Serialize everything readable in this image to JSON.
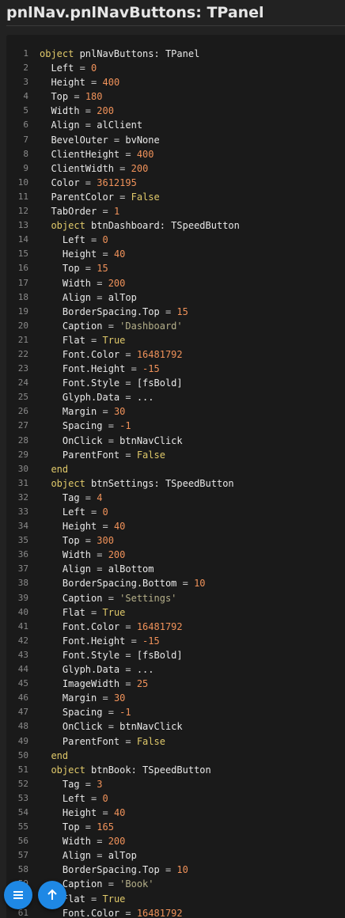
{
  "header": {
    "title": "pnlNav.pnlNavButtons: TPanel"
  },
  "colors": {
    "accent": "#1e88e5",
    "keyword": "#e0c96a",
    "number": "#f0925a",
    "string": "#b5b08a",
    "background": "#1a1a1a"
  },
  "code": {
    "lines": [
      [
        [
          "kw",
          "object"
        ],
        [
          "id",
          " pnlNavButtons: TPanel"
        ]
      ],
      [
        [
          "id",
          "  Left "
        ],
        [
          "op",
          "="
        ],
        [
          "num",
          " 0"
        ]
      ],
      [
        [
          "id",
          "  Height "
        ],
        [
          "op",
          "="
        ],
        [
          "num",
          " 400"
        ]
      ],
      [
        [
          "id",
          "  Top "
        ],
        [
          "op",
          "="
        ],
        [
          "num",
          " 180"
        ]
      ],
      [
        [
          "id",
          "  Width "
        ],
        [
          "op",
          "="
        ],
        [
          "num",
          " 200"
        ]
      ],
      [
        [
          "id",
          "  Align "
        ],
        [
          "op",
          "="
        ],
        [
          "id",
          " alClient"
        ]
      ],
      [
        [
          "id",
          "  BevelOuter "
        ],
        [
          "op",
          "="
        ],
        [
          "id",
          " bvNone"
        ]
      ],
      [
        [
          "id",
          "  ClientHeight "
        ],
        [
          "op",
          "="
        ],
        [
          "num",
          " 400"
        ]
      ],
      [
        [
          "id",
          "  ClientWidth "
        ],
        [
          "op",
          "="
        ],
        [
          "num",
          " 200"
        ]
      ],
      [
        [
          "id",
          "  Color "
        ],
        [
          "op",
          "="
        ],
        [
          "num",
          " 3612195"
        ]
      ],
      [
        [
          "id",
          "  ParentColor "
        ],
        [
          "op",
          "="
        ],
        [
          "kw",
          " False"
        ]
      ],
      [
        [
          "id",
          "  TabOrder "
        ],
        [
          "op",
          "="
        ],
        [
          "num",
          " 1"
        ]
      ],
      [
        [
          "kw",
          "  object"
        ],
        [
          "id",
          " btnDashboard: TSpeedButton"
        ]
      ],
      [
        [
          "id",
          "    Left "
        ],
        [
          "op",
          "="
        ],
        [
          "num",
          " 0"
        ]
      ],
      [
        [
          "id",
          "    Height "
        ],
        [
          "op",
          "="
        ],
        [
          "num",
          " 40"
        ]
      ],
      [
        [
          "id",
          "    Top "
        ],
        [
          "op",
          "="
        ],
        [
          "num",
          " 15"
        ]
      ],
      [
        [
          "id",
          "    Width "
        ],
        [
          "op",
          "="
        ],
        [
          "num",
          " 200"
        ]
      ],
      [
        [
          "id",
          "    Align "
        ],
        [
          "op",
          "="
        ],
        [
          "id",
          " alTop"
        ]
      ],
      [
        [
          "id",
          "    BorderSpacing.Top "
        ],
        [
          "op",
          "="
        ],
        [
          "num",
          " 15"
        ]
      ],
      [
        [
          "id",
          "    Caption "
        ],
        [
          "op",
          "="
        ],
        [
          "str",
          " 'Dashboard'"
        ]
      ],
      [
        [
          "id",
          "    Flat "
        ],
        [
          "op",
          "="
        ],
        [
          "kw",
          " True"
        ]
      ],
      [
        [
          "id",
          "    Font.Color "
        ],
        [
          "op",
          "="
        ],
        [
          "num",
          " 16481792"
        ]
      ],
      [
        [
          "id",
          "    Font.Height "
        ],
        [
          "op",
          "="
        ],
        [
          "num",
          " -15"
        ]
      ],
      [
        [
          "id",
          "    Font.Style "
        ],
        [
          "op",
          "="
        ],
        [
          "id",
          " [fsBold]"
        ]
      ],
      [
        [
          "id",
          "    Glyph.Data "
        ],
        [
          "op",
          "="
        ],
        [
          "id",
          " ..."
        ]
      ],
      [
        [
          "id",
          "    Margin "
        ],
        [
          "op",
          "="
        ],
        [
          "num",
          " 30"
        ]
      ],
      [
        [
          "id",
          "    Spacing "
        ],
        [
          "op",
          "="
        ],
        [
          "num",
          " -1"
        ]
      ],
      [
        [
          "id",
          "    OnClick "
        ],
        [
          "op",
          "="
        ],
        [
          "id",
          " btnNavClick"
        ]
      ],
      [
        [
          "id",
          "    ParentFont "
        ],
        [
          "op",
          "="
        ],
        [
          "kw",
          " False"
        ]
      ],
      [
        [
          "kw",
          "  end"
        ]
      ],
      [
        [
          "kw",
          "  object"
        ],
        [
          "id",
          " btnSettings: TSpeedButton"
        ]
      ],
      [
        [
          "id",
          "    Tag "
        ],
        [
          "op",
          "="
        ],
        [
          "num",
          " 4"
        ]
      ],
      [
        [
          "id",
          "    Left "
        ],
        [
          "op",
          "="
        ],
        [
          "num",
          " 0"
        ]
      ],
      [
        [
          "id",
          "    Height "
        ],
        [
          "op",
          "="
        ],
        [
          "num",
          " 40"
        ]
      ],
      [
        [
          "id",
          "    Top "
        ],
        [
          "op",
          "="
        ],
        [
          "num",
          " 300"
        ]
      ],
      [
        [
          "id",
          "    Width "
        ],
        [
          "op",
          "="
        ],
        [
          "num",
          " 200"
        ]
      ],
      [
        [
          "id",
          "    Align "
        ],
        [
          "op",
          "="
        ],
        [
          "id",
          " alBottom"
        ]
      ],
      [
        [
          "id",
          "    BorderSpacing.Bottom "
        ],
        [
          "op",
          "="
        ],
        [
          "num",
          " 10"
        ]
      ],
      [
        [
          "id",
          "    Caption "
        ],
        [
          "op",
          "="
        ],
        [
          "str",
          " 'Settings'"
        ]
      ],
      [
        [
          "id",
          "    Flat "
        ],
        [
          "op",
          "="
        ],
        [
          "kw",
          " True"
        ]
      ],
      [
        [
          "id",
          "    Font.Color "
        ],
        [
          "op",
          "="
        ],
        [
          "num",
          " 16481792"
        ]
      ],
      [
        [
          "id",
          "    Font.Height "
        ],
        [
          "op",
          "="
        ],
        [
          "num",
          " -15"
        ]
      ],
      [
        [
          "id",
          "    Font.Style "
        ],
        [
          "op",
          "="
        ],
        [
          "id",
          " [fsBold]"
        ]
      ],
      [
        [
          "id",
          "    Glyph.Data "
        ],
        [
          "op",
          "="
        ],
        [
          "id",
          " ..."
        ]
      ],
      [
        [
          "id",
          "    ImageWidth "
        ],
        [
          "op",
          "="
        ],
        [
          "num",
          " 25"
        ]
      ],
      [
        [
          "id",
          "    Margin "
        ],
        [
          "op",
          "="
        ],
        [
          "num",
          " 30"
        ]
      ],
      [
        [
          "id",
          "    Spacing "
        ],
        [
          "op",
          "="
        ],
        [
          "num",
          " -1"
        ]
      ],
      [
        [
          "id",
          "    OnClick "
        ],
        [
          "op",
          "="
        ],
        [
          "id",
          " btnNavClick"
        ]
      ],
      [
        [
          "id",
          "    ParentFont "
        ],
        [
          "op",
          "="
        ],
        [
          "kw",
          " False"
        ]
      ],
      [
        [
          "kw",
          "  end"
        ]
      ],
      [
        [
          "kw",
          "  object"
        ],
        [
          "id",
          " btnBook: TSpeedButton"
        ]
      ],
      [
        [
          "id",
          "    Tag "
        ],
        [
          "op",
          "="
        ],
        [
          "num",
          " 3"
        ]
      ],
      [
        [
          "id",
          "    Left "
        ],
        [
          "op",
          "="
        ],
        [
          "num",
          " 0"
        ]
      ],
      [
        [
          "id",
          "    Height "
        ],
        [
          "op",
          "="
        ],
        [
          "num",
          " 40"
        ]
      ],
      [
        [
          "id",
          "    Top "
        ],
        [
          "op",
          "="
        ],
        [
          "num",
          " 165"
        ]
      ],
      [
        [
          "id",
          "    Width "
        ],
        [
          "op",
          "="
        ],
        [
          "num",
          " 200"
        ]
      ],
      [
        [
          "id",
          "    Align "
        ],
        [
          "op",
          "="
        ],
        [
          "id",
          " alTop"
        ]
      ],
      [
        [
          "id",
          "    BorderSpacing.Top "
        ],
        [
          "op",
          "="
        ],
        [
          "num",
          " 10"
        ]
      ],
      [
        [
          "id",
          "    Caption "
        ],
        [
          "op",
          "="
        ],
        [
          "str",
          " 'Book'"
        ]
      ],
      [
        [
          "id",
          "    Flat "
        ],
        [
          "op",
          "="
        ],
        [
          "kw",
          " True"
        ]
      ],
      [
        [
          "id",
          "    Font.Color "
        ],
        [
          "op",
          "="
        ],
        [
          "num",
          " 16481792"
        ]
      ]
    ]
  },
  "fabs": {
    "menu_icon": "menu-icon",
    "up_icon": "arrow-up-icon"
  }
}
